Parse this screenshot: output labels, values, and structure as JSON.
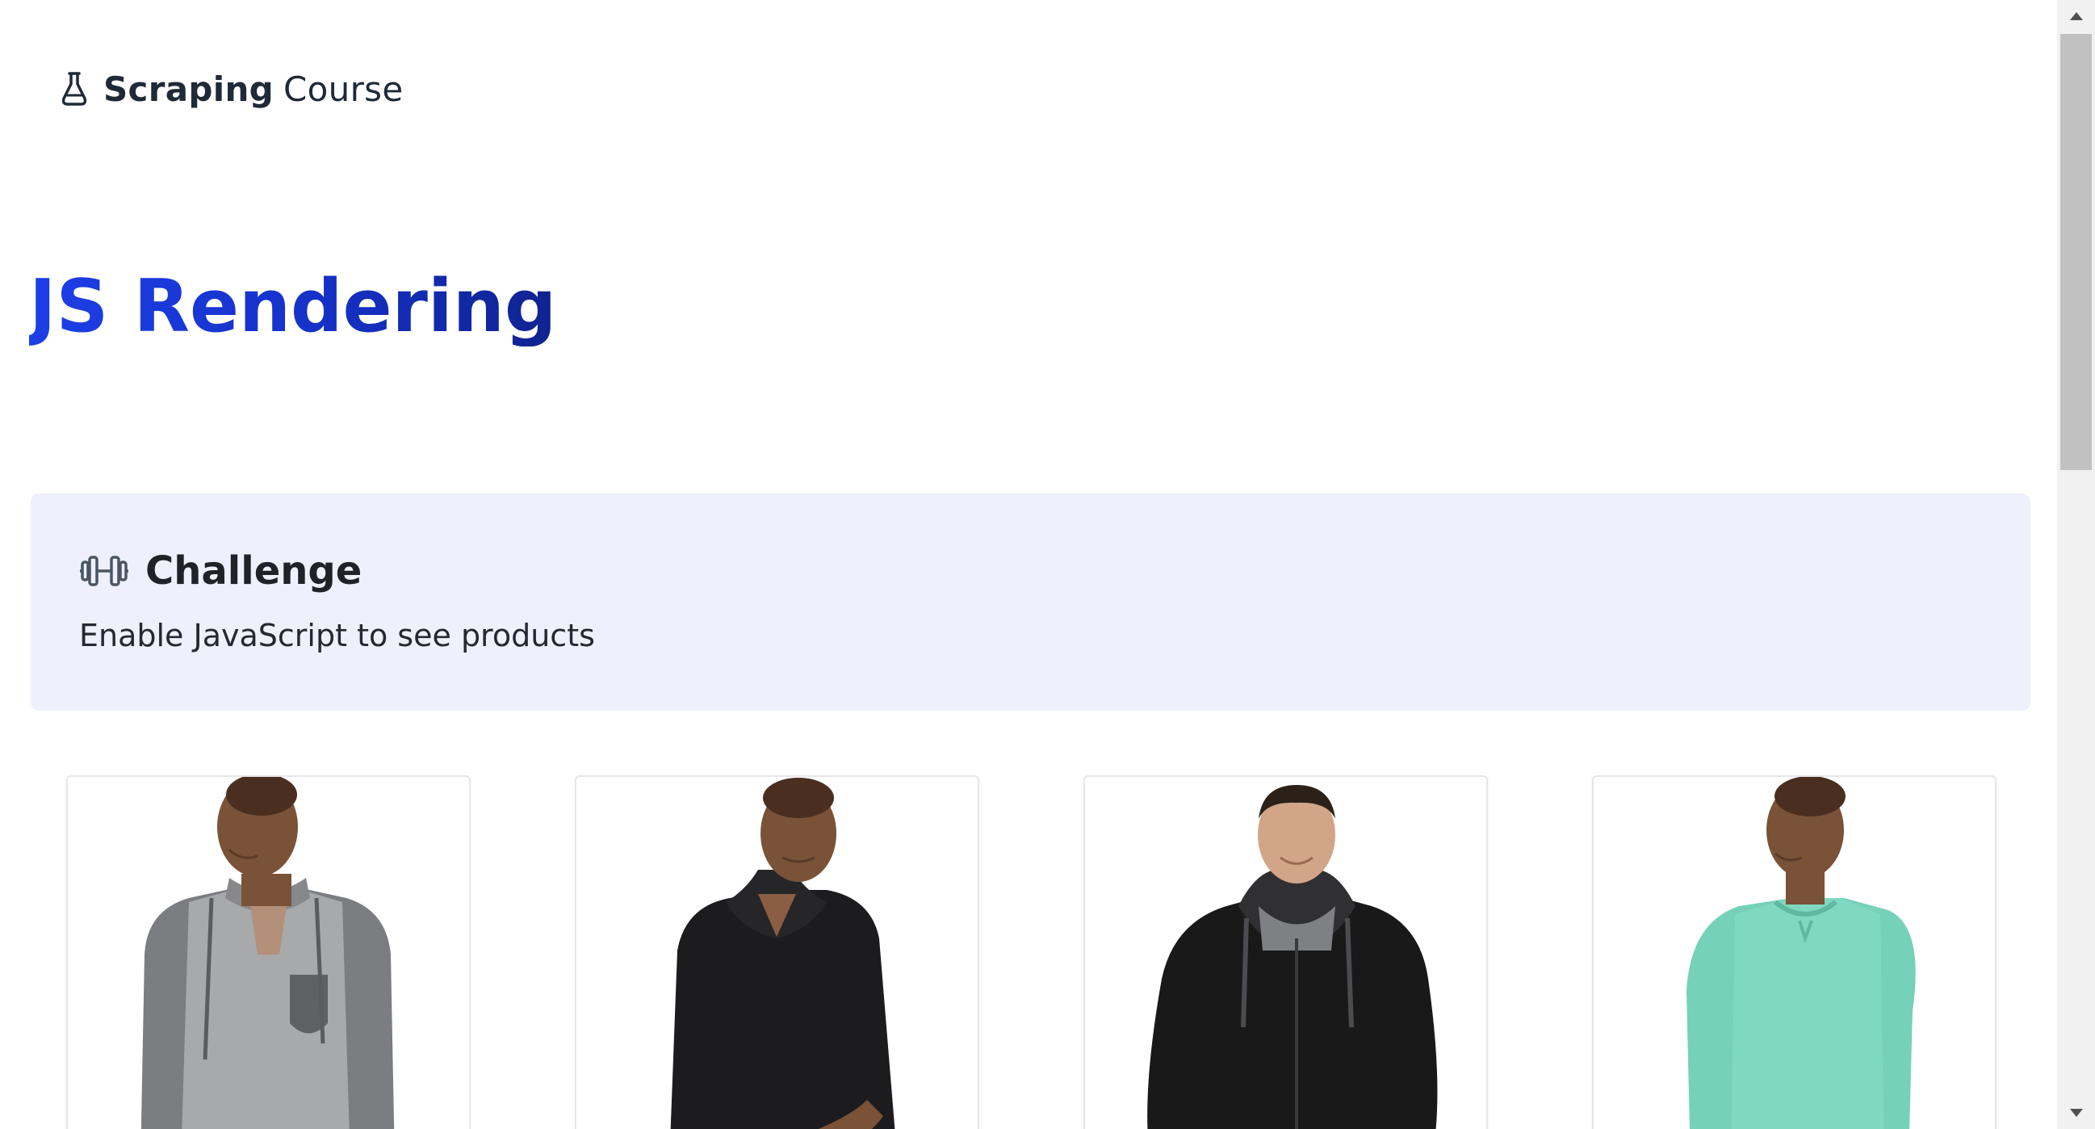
{
  "logo": {
    "bold_text": "Scraping",
    "light_text": "Course",
    "icon": "flask-icon"
  },
  "page": {
    "title": "JS Rendering"
  },
  "challenge": {
    "icon": "dumbbell-icon",
    "title": "Challenge",
    "text": "Enable JavaScript to see products"
  },
  "products": [
    {
      "image": "man-in-grey-henley-hoodie",
      "shirt_color": "#a7a9ab",
      "sleeve_color": "#7b7d80"
    },
    {
      "image": "man-in-black-hoodie",
      "shirt_color": "#1c1c1e",
      "sleeve_color": "#1c1c1e"
    },
    {
      "image": "man-in-black-zip-hoodie",
      "shirt_color": "#191919",
      "sleeve_color": "#191919"
    },
    {
      "image": "man-in-mint-sweatshirt",
      "shirt_color": "#7fd9c0",
      "sleeve_color": "#75d1b7"
    }
  ],
  "colors": {
    "title_blue": "#1736d8",
    "challenge_bg": "#eef1fc",
    "text_dark": "#1f2328",
    "skin": "#7a5238",
    "skin_light": "#c79a7f"
  },
  "scrollbar": {
    "up_icon": "scroll-up-arrow-icon",
    "down_icon": "scroll-down-arrow-icon"
  }
}
